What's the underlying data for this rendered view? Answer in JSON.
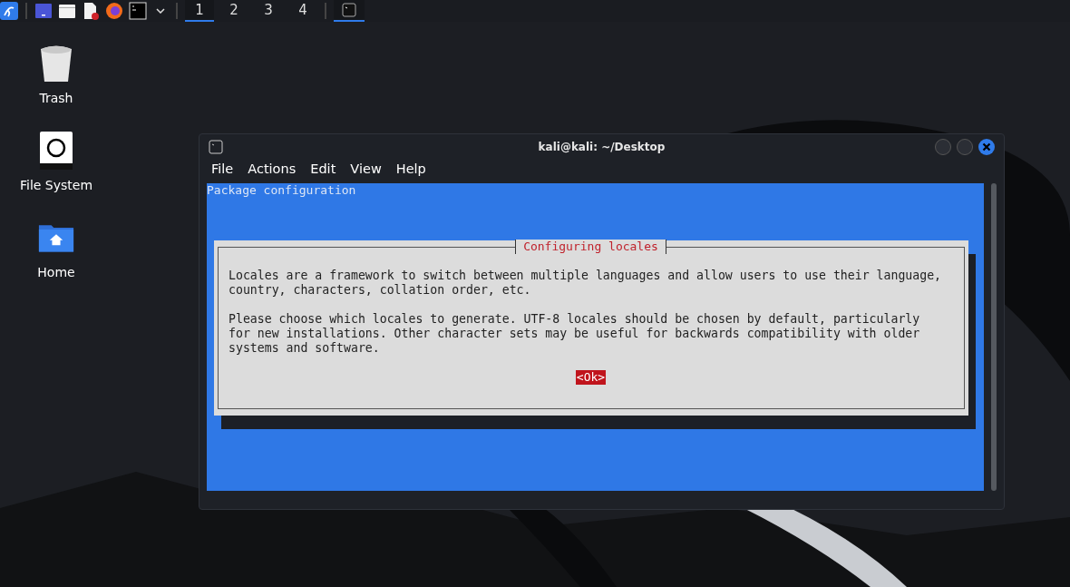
{
  "taskbar": {
    "workspaces": [
      {
        "label": "1",
        "selected": true
      },
      {
        "label": "2",
        "selected": false
      },
      {
        "label": "3",
        "selected": false
      },
      {
        "label": "4",
        "selected": false
      }
    ],
    "windows": [
      {
        "kind": "terminal",
        "selected": true
      }
    ]
  },
  "desktop_icons": [
    {
      "label": "Trash",
      "kind": "trash"
    },
    {
      "label": "File System",
      "kind": "drive"
    },
    {
      "label": "Home",
      "kind": "home"
    }
  ],
  "window": {
    "title": "kali@kali: ~/Desktop",
    "menu": [
      "File",
      "Actions",
      "Edit",
      "View",
      "Help"
    ],
    "terminal": {
      "header": "Package configuration",
      "dialog": {
        "title": "Configuring locales",
        "paragraphs": [
          "Locales are a framework to switch between multiple languages and allow users to use their language,\ncountry, characters, collation order, etc.",
          "Please choose which locales to generate. UTF-8 locales should be chosen by default, particularly\nfor new installations. Other character sets may be useful for backwards compatibility with older\nsystems and software."
        ],
        "button": {
          "label": "<Ok>",
          "selected": true
        }
      }
    }
  }
}
